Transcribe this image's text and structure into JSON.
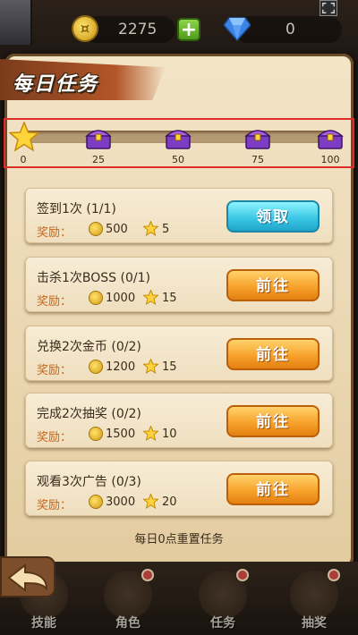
{
  "topbar": {
    "coins": "2275",
    "gems": "0",
    "add_label": "+"
  },
  "panel": {
    "title": "每日任务",
    "reset_note": "每日0点重置任务"
  },
  "progress": {
    "current": 0,
    "milestones": [
      "0",
      "25",
      "50",
      "75",
      "100"
    ]
  },
  "reward_label": "奖励：",
  "tasks": [
    {
      "title": "签到1次 (1/1)",
      "coins": "500",
      "stars": "5",
      "button": "领取",
      "button_type": "claim"
    },
    {
      "title": "击杀1次BOSS (0/1)",
      "coins": "1000",
      "stars": "15",
      "button": "前往",
      "button_type": "go"
    },
    {
      "title": "兑换2次金币 (0/2)",
      "coins": "1200",
      "stars": "15",
      "button": "前往",
      "button_type": "go"
    },
    {
      "title": "完成2次抽奖 (0/2)",
      "coins": "1500",
      "stars": "10",
      "button": "前往",
      "button_type": "go"
    },
    {
      "title": "观看3次广告 (0/3)",
      "coins": "3000",
      "stars": "20",
      "button": "前往",
      "button_type": "go"
    }
  ],
  "nav": [
    {
      "label": "技能"
    },
    {
      "label": "角色"
    },
    {
      "label": "任务"
    },
    {
      "label": "抽奖"
    }
  ],
  "colors": {
    "claim": "#3dc8e6",
    "go": "#f7a22c",
    "progress_highlight": "#e12a2a"
  }
}
